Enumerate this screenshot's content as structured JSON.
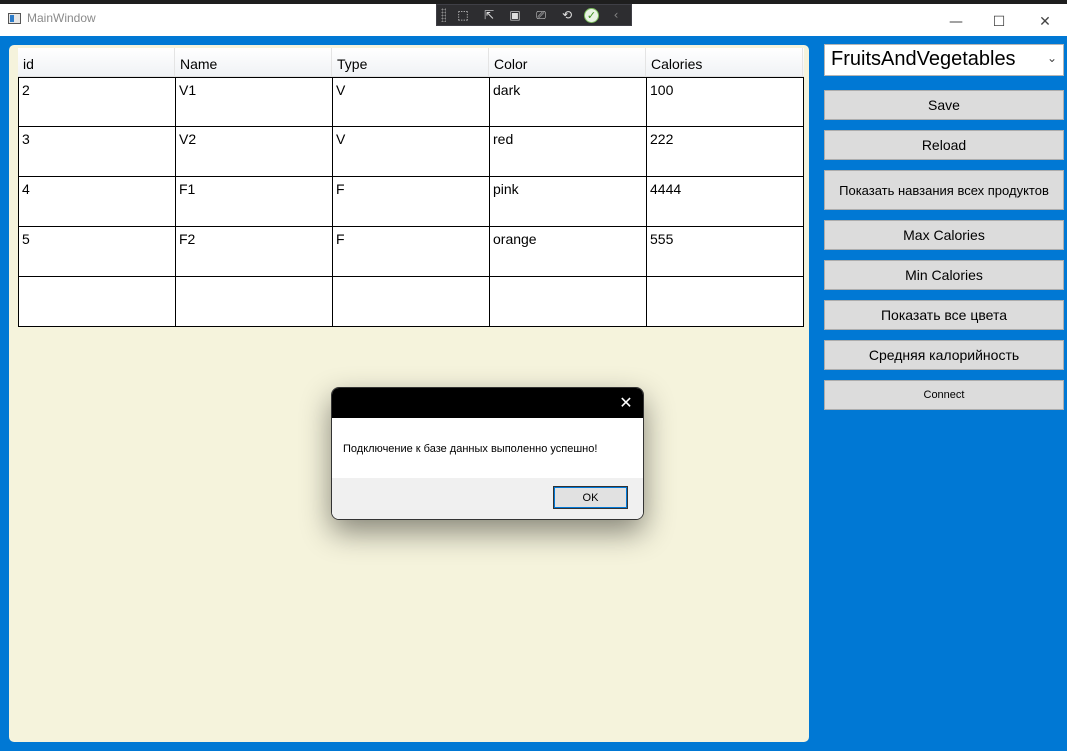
{
  "window": {
    "title": "MainWindow"
  },
  "title_controls": {
    "minimize": "—",
    "maximize": "☐",
    "close": "✕"
  },
  "debug_toolbar": {
    "buttons": [
      {
        "name": "select-element-icon",
        "glyph": "⬚"
      },
      {
        "name": "cursor-select-icon",
        "glyph": "⇱"
      },
      {
        "name": "layout-adorner-icon",
        "glyph": "▣"
      },
      {
        "name": "track-focus-icon",
        "glyph": "⎚"
      },
      {
        "name": "hot-reload-icon",
        "glyph": "⟲"
      }
    ],
    "check_glyph": "✓",
    "collapse_glyph": "‹"
  },
  "grid": {
    "columns": [
      "id",
      "Name",
      "Type",
      "Color",
      "Calories"
    ],
    "rows": [
      [
        "2",
        "V1",
        "V",
        "dark",
        "100"
      ],
      [
        "3",
        "V2",
        "V",
        "red",
        "222"
      ],
      [
        "4",
        "F1",
        "F",
        "pink",
        "4444"
      ],
      [
        "5",
        "F2",
        "F",
        "orange",
        "555"
      ],
      [
        "",
        "",
        "",
        "",
        ""
      ]
    ]
  },
  "sidebar": {
    "table_select": {
      "value": "FruitsAndVegetables",
      "chevron": "⌄"
    },
    "buttons": {
      "save": "Save",
      "reload": "Reload",
      "show_names": "Показать навзания всех продуктов",
      "max_calories": "Max Calories",
      "min_calories": "Min Calories",
      "show_colors": "Показать все цвета",
      "avg_calories": "Средняя калорийность",
      "connect": "Connect"
    }
  },
  "dialog": {
    "close_glyph": "✕",
    "message": "Подключение к базе данных выполенно успешно!",
    "ok_label": "OK"
  },
  "colors": {
    "window_background": "#0078d4",
    "content_background": "#f5f3dc",
    "button_background": "#dcdcdc",
    "dialog_title_background": "#000000"
  }
}
